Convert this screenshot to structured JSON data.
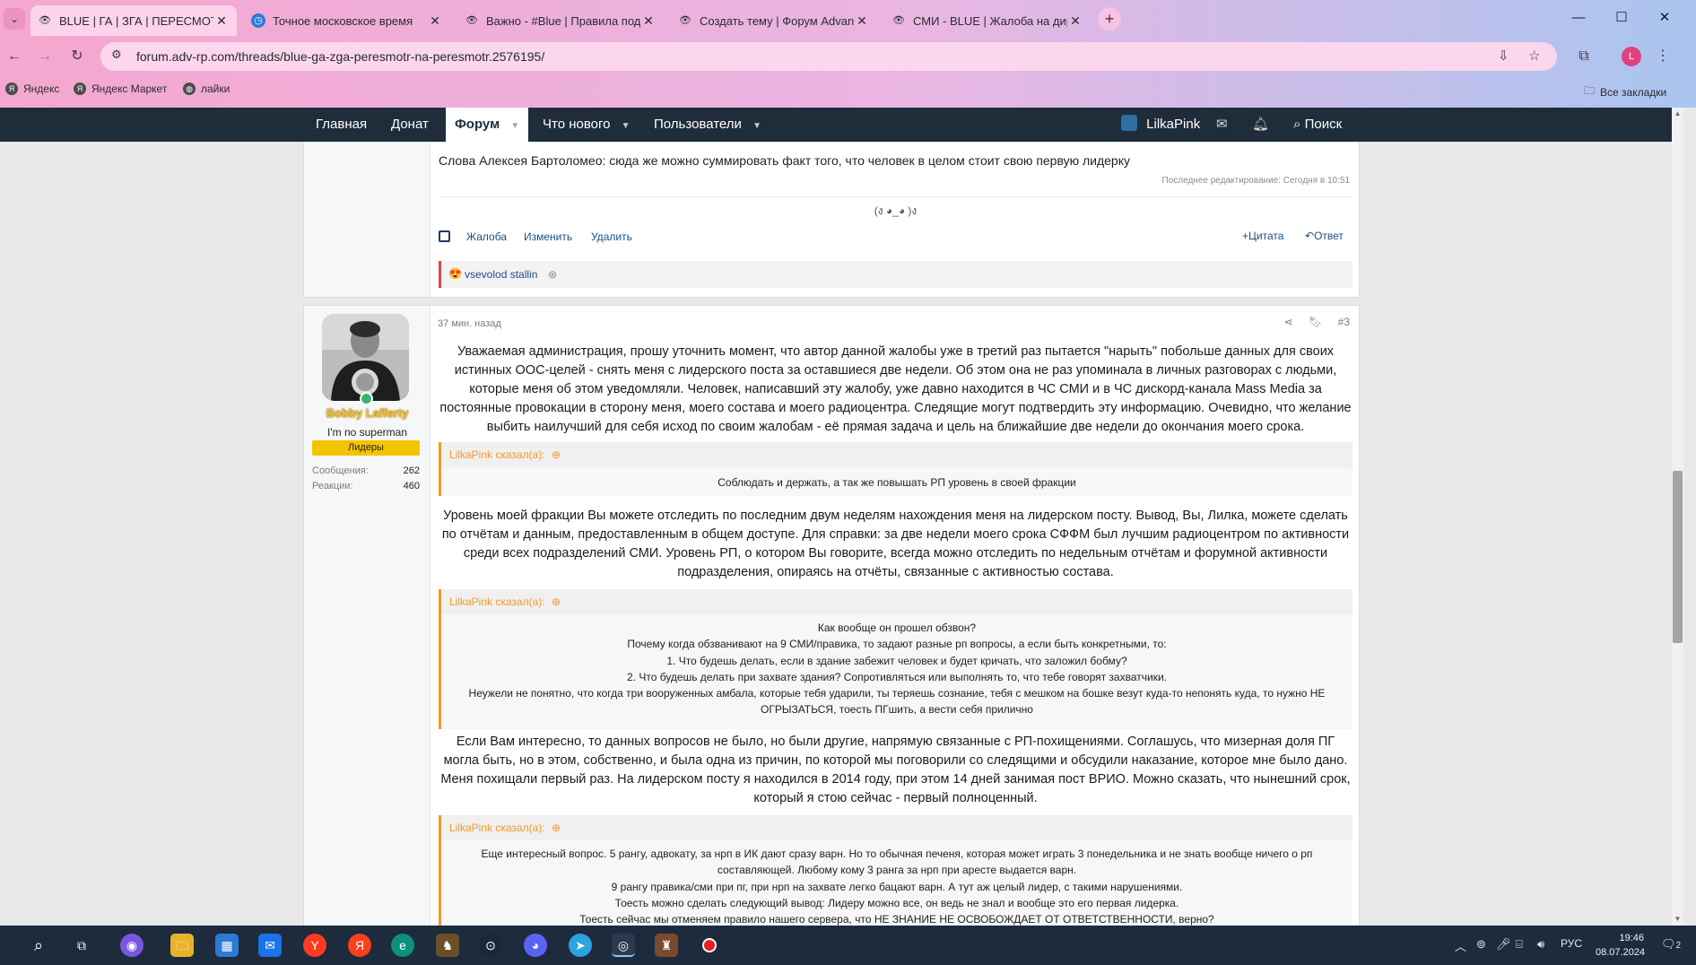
{
  "browser": {
    "tabs": [
      {
        "title": "BLUE | ГА | ЗГА | ПЕРЕСМОТР Н",
        "active": true
      },
      {
        "title": "Точное московское время",
        "active": false
      },
      {
        "title": "Важно - #Blue | Правила пода",
        "active": false
      },
      {
        "title": "Создать тему | Форум Advance",
        "active": false
      },
      {
        "title": "СМИ - BLUE | Жалоба на дире",
        "active": false
      }
    ],
    "url": "forum.adv-rp.com/threads/blue-ga-zga-peresmotr-na-peresmotr.2576195/",
    "profile_initial": "L",
    "bookmarks": [
      "Яндекс",
      "Яндекс Маркет",
      "лайки"
    ],
    "all_bookmarks": "Все закладки",
    "accent": "#f4a7cf"
  },
  "site_nav": {
    "home": "Главная",
    "donate": "Донат",
    "forum": "Форум",
    "whats_new": "Что нового",
    "users": "Пользователи",
    "username": "LilkaPink",
    "search": "Поиск"
  },
  "post_prev": {
    "text": "Слова Алексея Бартоломео: сюда же можно суммировать факт того, что человек в целом стоит свою первую лидерку",
    "last_edit": "Последнее редактирование: Сегодня в 10:51",
    "signature": "(ง ◕_◕ )ง",
    "actions": {
      "report": "Жалоба",
      "edit": "Изменить",
      "delete": "Удалить",
      "quote": "Цитата",
      "reply": "Ответ"
    },
    "reaction_user": "vsevolod stallin"
  },
  "post3": {
    "author": {
      "name": "Bobby Lafferty",
      "title": "I'm no superman",
      "badge": "Лидеры",
      "messages_label": "Сообщения:",
      "messages": "262",
      "reactions_label": "Реакции:",
      "reactions": "460"
    },
    "time": "37 мин. назад",
    "number": "#3",
    "p1": "Уважаемая администрация, прошу уточнить момент, что автор данной жалобы уже в третий раз пытается \"нарыть\" побольше данных для своих истинных ООС-целей - снять меня с лидерского поста за оставшиеся две недели. Об этом она не раз упоминала в личных разговорах с людьми, которые меня об этом уведомляли. Человек, написавший эту жалобу, уже давно находится в ЧС СМИ и в ЧС дискорд-канала Mass Media за постоянные провокации в сторону меня, моего состава и моего радиоцентра. Следящие могут подтвердить эту информацию. Очевидно, что желание выбить наилучший для себя исход по своим жалобам - её прямая задача и цель на ближайшие две недели до окончания моего срока.",
    "q1_header": "LilkaPink сказал(а):",
    "q1": "Соблюдать и держать, а так же повышать РП уровень в своей фракции",
    "p2": "Уровень моей фракции Вы можете отследить по последним двум неделям нахождения меня на лидерском посту. Вывод, Вы, Лилка, можете сделать по отчётам и данным, предоставленным в общем доступе. Для справки: за две недели моего срока СФФМ был лучшим радиоцентром по активности среди всех подразделений СМИ. Уровень РП, о котором Вы говорите, всегда можно отследить по недельным отчётам и форумной активности подразделения, опираясь на отчёты, связанные с активностью состава.",
    "q2_header": "LilkaPink сказал(а):",
    "q2_lines": [
      "Как вообще он прошел обзвон?",
      "Почему когда обзванивают на 9 СМИ/правика, то задают разные рп вопросы, а если быть конкретными, то:",
      "1. Что будешь делать, если в здание забежит человек и будет кричать, что заложил бобму?",
      "2. Что будешь делать при захвате здания? Сопротивляться или выполнять то, что тебе говорят захватчики.",
      "Неужели не понятно, что когда три вооруженных амбала, которые тебя ударили, ты теряешь сознание, тебя с мешком на бошке везут куда-то непонять куда, то нужно НЕ ОГРЫЗАТЬСЯ, тоесть ПГшить, а вести себя прилично"
    ],
    "p3": "Если Вам интересно, то данных вопросов не было, но были другие, напрямую связанные с РП-похищениями. Соглашусь, что мизерная доля ПГ могла быть, но в этом, собственно, и была одна из причин, по которой мы поговорили со следящими и обсудили наказание, которое мне было дано. Меня похищали первый раз. На лидерском посту я находился в 2014 году, при этом 14 дней занимая пост ВРИО. Можно сказать, что нынешний срок, который я стою сейчас - первый полноценный.",
    "q3_header": "LilkaPink сказал(а):",
    "q3_lines": [
      "Еще интересный вопрос. 5 рангу, адвокату, за нрп в ИК дают сразу варн. Но то обычная печеня, которая может играть 3 понедельника и не знать вообще ничего о рп составляющей. Любому кому 3 ранга за нрп при аресте выдается варн.",
      "9 рангу правика/сми при пг, при нрп на захвате легко бацают варн. А тут аж целый лидер, с такими нарушениями.",
      "Тоесть можно сделать следующий вывод: Лидеру можно все, он ведь не знал и вообще это его первая лидерка.",
      "Тоесть сейчас мы отменяем правило нашего сервера, что НЕ ЗНАНИЕ НЕ ОСВОБОЖДАЕТ ОТ ОТВЕТСТВЕННОСТИ, верно?"
    ]
  },
  "taskbar": {
    "lang": "РУС",
    "time": "19:46",
    "date": "08.07.2024",
    "notifications": "2"
  }
}
